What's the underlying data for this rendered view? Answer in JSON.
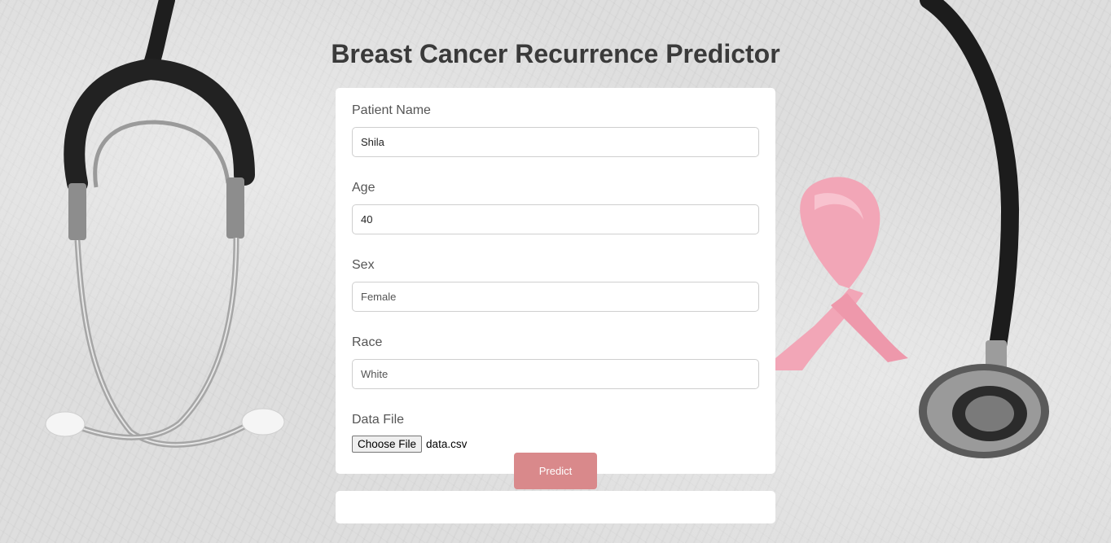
{
  "page": {
    "title": "Breast Cancer Recurrence Predictor"
  },
  "form": {
    "patient_name": {
      "label": "Patient Name",
      "value": "Shila"
    },
    "age": {
      "label": "Age",
      "value": "40"
    },
    "sex": {
      "label": "Sex",
      "value": "Female"
    },
    "race": {
      "label": "Race",
      "value": "White"
    },
    "data_file": {
      "label": "Data File",
      "button_label": "Choose File",
      "file_name": "data.csv"
    },
    "submit_label": "Predict"
  },
  "result": {
    "text": ""
  },
  "colors": {
    "predict_button": "#d9898b",
    "title": "#3a3a3a",
    "ribbon": "#f0a2b4"
  },
  "background_icons": [
    "stethoscope-icon",
    "pink-ribbon-icon"
  ]
}
